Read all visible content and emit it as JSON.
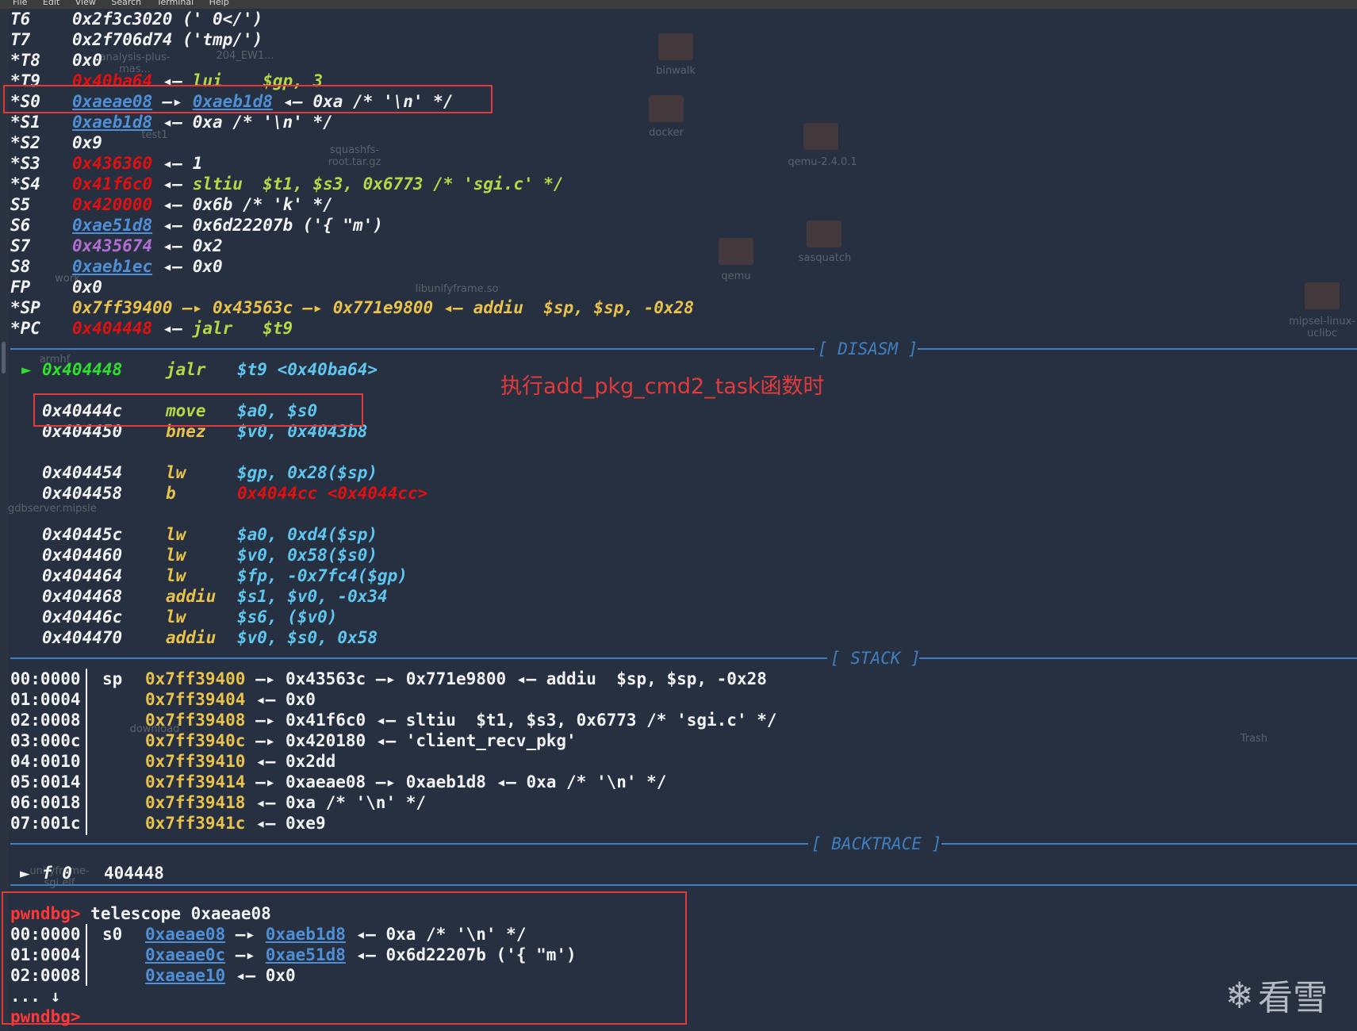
{
  "menu": [
    "File",
    "Edit",
    "View",
    "Search",
    "Terminal",
    "Help"
  ],
  "registers": [
    {
      "name": "T6",
      "value": "0x2f3c3020 (' 0</')"
    },
    {
      "name": "T7",
      "value": "0x2f706d74 ('tmp/')"
    },
    {
      "name": "*T8",
      "value": "0x0"
    },
    {
      "name": "*T9",
      "addr": "0x40ba64",
      "rest": "lui    $gp, 3"
    },
    {
      "name": "*S0",
      "a1": "0xaeae08",
      "a2": "0xaeb1d8",
      "rest": "0xa /* '\\n' */"
    },
    {
      "name": "*S1",
      "a1": "0xaeb1d8",
      "rest": "0xa /* '\\n' */"
    },
    {
      "name": "*S2",
      "value": "0x9"
    },
    {
      "name": "*S3",
      "addr": "0x436360",
      "rest": "1"
    },
    {
      "name": "*S4",
      "addr": "0x41f6c0",
      "rest": "sltiu  $t1, $s3, 0x6773 /* 'sgi.c' */"
    },
    {
      "name": "S5",
      "addr": "0x420000",
      "rest": "0x6b /* 'k' */"
    },
    {
      "name": "S6",
      "a1": "0xae51d8",
      "rest": "0x6d22207b ('{ \"m')"
    },
    {
      "name": "S7",
      "addr": "0x435674",
      "rest": "0x2"
    },
    {
      "name": "S8",
      "a1": "0xaeb1ec",
      "rest": "0x0"
    },
    {
      "name": "FP",
      "value": "0x0"
    },
    {
      "name": "*SP",
      "value": "0x7ff39400 —▸ 0x43563c —▸ 0x771e9800 ◂— addiu  $sp, $sp, -0x28"
    },
    {
      "name": "*PC",
      "addr": "0x404448",
      "rest": "jalr   $t9"
    }
  ],
  "sections": {
    "disasm": "[ DISASM ]",
    "stack": "[ STACK ]",
    "backtrace": "[ BACKTRACE ]"
  },
  "disasm": [
    {
      "addr": "0x404448",
      "mn": "jalr",
      "ops": "$t9 <0x40ba64>",
      "current": true
    },
    {
      "addr": "0x40444c",
      "mn": "move",
      "ops": "$a0, $s0"
    },
    {
      "addr": "0x404450",
      "mn": "bnez",
      "ops": "$v0, 0x4043b8"
    },
    {
      "addr": "0x404454",
      "mn": "lw",
      "ops": "$gp, 0x28($sp)"
    },
    {
      "addr": "0x404458",
      "mn": "b",
      "ops": "0x4044cc <0x4044cc>"
    },
    {
      "addr": "0x40445c",
      "mn": "lw",
      "ops": "$a0, 0xd4($sp)"
    },
    {
      "addr": "0x404460",
      "mn": "lw",
      "ops": "$v0, 0x58($s0)"
    },
    {
      "addr": "0x404464",
      "mn": "lw",
      "ops": "$fp, -0x7fc4($gp)"
    },
    {
      "addr": "0x404468",
      "mn": "addiu",
      "ops": "$s1, $v0, -0x34"
    },
    {
      "addr": "0x40446c",
      "mn": "lw",
      "ops": "$s6, ($v0)"
    },
    {
      "addr": "0x404470",
      "mn": "addiu",
      "ops": "$v0, $s0, 0x58"
    }
  ],
  "annotation": "执行add_pkg_cmd2_task函数时",
  "stack": [
    {
      "off": "00:0000",
      "reg": "sp",
      "addr": "0x7ff39400",
      "rest": "0x43563c —▸ 0x771e9800 ◂— addiu  $sp, $sp, -0x28"
    },
    {
      "off": "01:0004",
      "addr": "0x7ff39404",
      "rest": "0x0"
    },
    {
      "off": "02:0008",
      "addr": "0x7ff39408",
      "rest": "0x41f6c0 ◂— sltiu  $t1, $s3, 0x6773 /* 'sgi.c' */"
    },
    {
      "off": "03:000c",
      "addr": "0x7ff3940c",
      "rest": "0x420180 ◂— 'client_recv_pkg'"
    },
    {
      "off": "04:0010",
      "addr": "0x7ff39410",
      "rest": "0x2dd"
    },
    {
      "off": "05:0014",
      "addr": "0x7ff39414",
      "rest": "0xaeae08 —▸ 0xaeb1d8 ◂— 0xa /* '\\n' */"
    },
    {
      "off": "06:0018",
      "addr": "0x7ff39418",
      "rest": "0xa /* '\\n' */"
    },
    {
      "off": "07:001c",
      "addr": "0x7ff3941c",
      "rest": "0xe9"
    }
  ],
  "backtrace": {
    "frame": "f 0",
    "addr": "404448"
  },
  "telescope": {
    "prompt": "pwndbg>",
    "command": "telescope 0xaeae08",
    "rows": [
      {
        "off": "00:0000",
        "reg": "s0",
        "a1": "0xaeae08",
        "a2": "0xaeb1d8",
        "rest": "0xa /* '\\n' */"
      },
      {
        "off": "01:0004",
        "a1": "0xaeae0c",
        "a2": "0xae51d8",
        "rest": "0x6d22207b ('{ \"m')"
      },
      {
        "off": "02:0008",
        "a1": "0xaeae10",
        "rest": "0x0"
      }
    ],
    "ellipsis": "... ↓"
  },
  "desktop_icons": [
    "binwalk",
    "docker",
    "qemu-2.4.0.1",
    "sasquatch",
    "qemu",
    "mipsel-linux-uclibc",
    "squashfs-root.tar.gz",
    "libunifyframe.so",
    "test1",
    "Trash",
    "download",
    "gdbserver.mipsle",
    "unifyframe-sgi.elf",
    "analysis-plus-mas...",
    "204_EW1...",
    "work",
    "armhf"
  ],
  "logo": "看雪"
}
